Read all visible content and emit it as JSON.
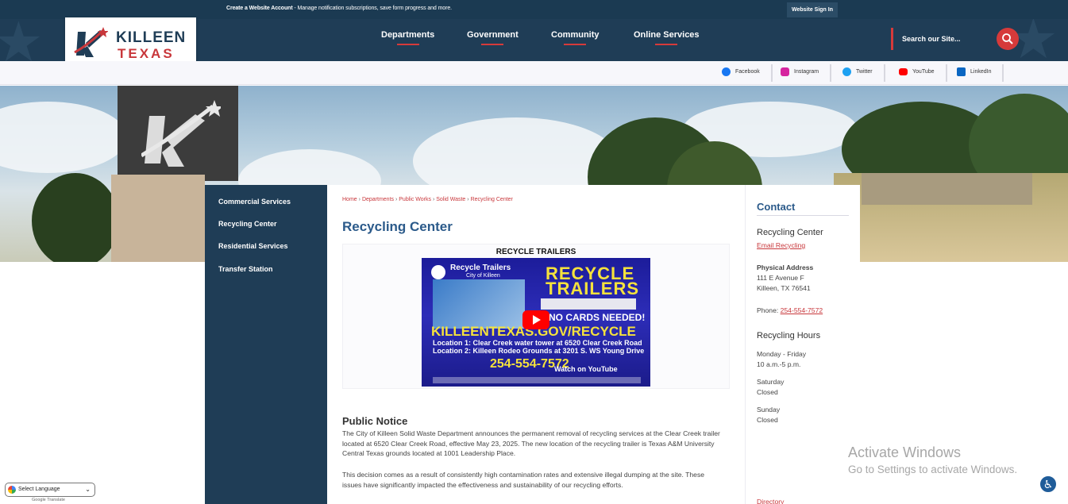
{
  "topbar": {
    "create_account": "Create a Website Account",
    "create_account_rest": " - Manage notification subscriptions, save form progress and more.",
    "sign_in": "Website Sign In"
  },
  "logo": {
    "line1": "KILLEEN",
    "line2": "TEXAS"
  },
  "nav": {
    "items": [
      {
        "label": "Departments"
      },
      {
        "label": "Government"
      },
      {
        "label": "Community"
      },
      {
        "label": "Online Services"
      }
    ]
  },
  "search": {
    "placeholder": "Search our Site..."
  },
  "social": {
    "items": [
      {
        "label": "Facebook",
        "color": "#1877f2"
      },
      {
        "label": "Instagram",
        "color": "#d6249f"
      },
      {
        "label": "Twitter",
        "color": "#1da1f2"
      },
      {
        "label": "YouTube",
        "color": "#ff0000"
      },
      {
        "label": "LinkedIn",
        "color": "#0a66c2"
      }
    ]
  },
  "sidenav": {
    "items": [
      {
        "label": "Commercial Services"
      },
      {
        "label": "Recycling Center"
      },
      {
        "label": "Residential Services"
      },
      {
        "label": "Transfer Station"
      }
    ]
  },
  "breadcrumb": {
    "items": [
      "Home",
      "Departments",
      "Public Works",
      "Solid Waste",
      "Recycling Center"
    ],
    "sep": "›"
  },
  "page": {
    "title": "Recycling Center",
    "video_title": "RECYCLE TRAILERS",
    "video": {
      "channel": "Recycle Trailers",
      "channel_sub": "City of Killeen",
      "headline1": "RECYCLE",
      "headline2": "TRAILERS",
      "no_cards": "NO CARDS NEEDED!",
      "url": "KILLEENTEXAS.GOV/RECYCLE",
      "loc1": "Location 1: Clear Creek water tower at 6520 Clear Creek Road",
      "loc2": "Location 2: Killeen Rodeo Grounds at 3201 S. WS Young Drive",
      "phone": "254-554-7572",
      "watch_on": "Watch on",
      "youtube": "YouTube"
    },
    "notice_title": "Public Notice",
    "paragraphs": [
      "The City of Killeen Solid Waste Department announces the permanent removal of recycling services at the Clear Creek trailer located at 6520 Clear Creek Road, effective May 23, 2025. The new location of the recycling trailer is Texas A&M University Central Texas grounds located at 1001 Leadership Place.",
      "This decision comes as a result of consistently high contamination rates and extensive illegal dumping at the site. These issues have significantly impacted the effectiveness and sustainability of our recycling efforts."
    ]
  },
  "contact": {
    "heading": "Contact",
    "name": "Recycling Center",
    "email_link": "Email Recycling",
    "address_label": "Physical Address",
    "address1": "111 E Avenue F",
    "address2": "Killeen, TX 76541",
    "phone_label": "Phone: ",
    "phone": "254-554-7572",
    "hours_heading": "Recycling Hours",
    "hours": [
      {
        "day": "Monday - Friday",
        "time": "10 a.m.-5 p.m."
      },
      {
        "day": "Saturday",
        "time": "Closed"
      },
      {
        "day": "Sunday",
        "time": "Closed"
      }
    ],
    "directory": "Directory"
  },
  "overlay": {
    "activate1": "Activate Windows",
    "activate2": "Go to Settings to activate Windows.",
    "translate_label": "Select Language",
    "translate_credit_google": "Google",
    "translate_credit": "Translate"
  }
}
